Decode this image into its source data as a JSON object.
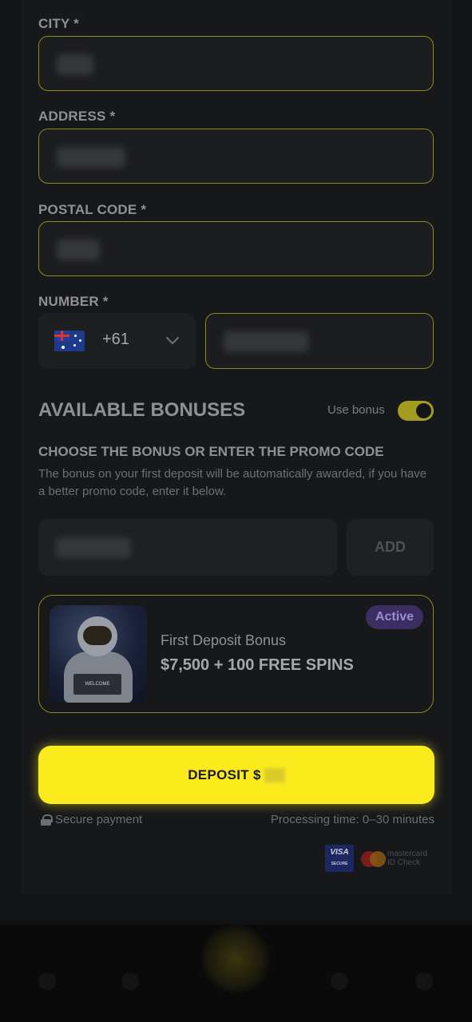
{
  "form": {
    "city": {
      "label": "CITY *",
      "value": ""
    },
    "address": {
      "label": "ADDRESS *",
      "value": ""
    },
    "postal_code": {
      "label": "POSTAL CODE *",
      "value": ""
    },
    "number": {
      "label": "NUMBER *",
      "country_code": "+61",
      "country": "Australia",
      "value": ""
    }
  },
  "bonuses": {
    "heading": "AVAILABLE BONUSES",
    "toggle_label": "Use bonus",
    "toggle_on": true,
    "choose_heading": "CHOOSE THE BONUS OR ENTER THE PROMO CODE",
    "description": "The bonus on your first deposit will be automatically awarded, if you have a better promo code, enter it below.",
    "promo_value": "",
    "add_label": "ADD",
    "card": {
      "badge": "Active",
      "name": "First Deposit Bonus",
      "amount": "$7,500 + 100 FREE SPINS",
      "image_sign": "WELCOME"
    }
  },
  "deposit": {
    "button_label": "DEPOSIT  $",
    "secure_label": "Secure payment",
    "processing": "Processing time: 0–30 minutes"
  },
  "payment_logos": {
    "visa": "VISA",
    "visa_sub": "SECURE",
    "mastercard": "mastercard ID Check"
  },
  "colors": {
    "accent": "#fbeb1d",
    "field_border": "#8e8a1c",
    "badge_bg": "#3c2d63"
  }
}
